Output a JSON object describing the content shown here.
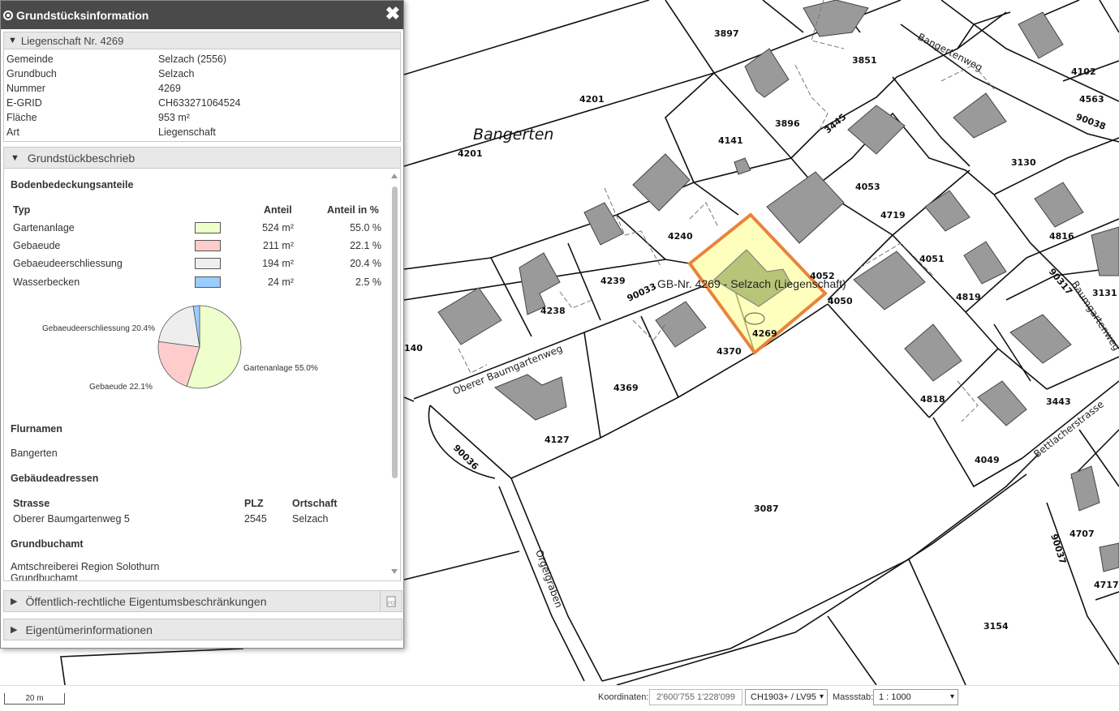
{
  "panel": {
    "title": "Grundstücksinformation",
    "close_label": "✖",
    "liegenschaft_header": "Liegenschaft Nr. 4269",
    "info": [
      {
        "key": "Gemeinde",
        "value": "Selzach (2556)"
      },
      {
        "key": "Grundbuch",
        "value": "Selzach"
      },
      {
        "key": "Nummer",
        "value": "4269"
      },
      {
        "key": "E-GRID",
        "value": "CH633271064524"
      },
      {
        "key": "Fläche",
        "value": "953 m²"
      },
      {
        "key": "Art",
        "value": "Liegenschaft"
      }
    ],
    "beschrieb_header": "Grundstückbeschrieb",
    "bodenbedeckung_title": "Bodenbedeckungsanteile",
    "cols": {
      "typ": "Typ",
      "anteil": "Anteil",
      "anteil_pct": "Anteil in %"
    },
    "rows": [
      {
        "typ": "Gartenanlage",
        "anteil": "524 m²",
        "pct": "55.0 %",
        "color": "#eeffcc"
      },
      {
        "typ": "Gebaeude",
        "anteil": "211 m²",
        "pct": "22.1 %",
        "color": "#ffcccc"
      },
      {
        "typ": "Gebaeudeerschliessung",
        "anteil": "194 m²",
        "pct": "20.4 %",
        "color": "#eeeeee"
      },
      {
        "typ": "Wasserbecken",
        "anteil": "24 m²",
        "pct": "2.5 %",
        "color": "#99ccff"
      }
    ],
    "pie_labels": {
      "garten": "Gartenanlage 55.0%",
      "gebaeude": "Gebaeude 22.1%",
      "erschl": "Gebaeudeerschliessung 20.4%"
    },
    "flurnamen_title": "Flurnamen",
    "flurnamen_value": "Bangerten",
    "adressen_title": "Gebäudeadressen",
    "adr_cols": {
      "strasse": "Strasse",
      "plz": "PLZ",
      "ort": "Ortschaft"
    },
    "adr_row": {
      "strasse": "Oberer Baumgartenweg 5",
      "plz": "2545",
      "ort": "Selzach"
    },
    "grundbuchamt_title": "Grundbuchamt",
    "grundbuchamt_value": "Amtschreiberei Region Solothurn Grundbuchamt",
    "oereb_header": "Öffentlich-rechtliche Eigentumsbeschränkungen",
    "eigentuemer_header": "Eigentümerinformationen"
  },
  "chart_data": {
    "type": "pie",
    "categories": [
      "Gartenanlage",
      "Gebaeude",
      "Gebaeudeerschliessung",
      "Wasserbecken"
    ],
    "values": [
      55.0,
      22.1,
      20.4,
      2.5
    ],
    "colors": [
      "#eeffcc",
      "#ffcccc",
      "#eeeeee",
      "#99ccff"
    ],
    "labels": [
      "Gartenanlage 55.0%",
      "Gebaeude 22.1%",
      "Gebaeudeerschliessung 20.4%"
    ]
  },
  "map": {
    "place_name": "Bangerten",
    "selection_label": "GB-Nr. 4269 - Selzach (Liegenschaft)",
    "parcels": [
      "3897",
      "3851",
      "4201",
      "4201",
      "3896",
      "4141",
      "4240",
      "4239",
      "4238",
      "4370",
      "4369",
      "4127",
      "3087",
      "4052",
      "4050",
      "4053",
      "4719",
      "4051",
      "4819",
      "4818",
      "4049",
      "3130",
      "4816",
      "3131",
      "3443",
      "4707",
      "4717",
      "3154",
      "4102",
      "4563",
      "140",
      "4269",
      "3445",
      "90038",
      "90033",
      "90036",
      "90317",
      "90037"
    ],
    "streets": [
      "Oberer Baumgartenweg",
      "Bangertenweg",
      "Baumgartenweg",
      "Bettlacherstrasse",
      "Orgelgraben"
    ]
  },
  "bottom": {
    "scale_label": "20 m",
    "coord_label": "Koordinaten:",
    "coord_value": "2'600'755 1'228'099",
    "crs_value": "CH1903+ / LV95",
    "scale_lbl": "Massstab:",
    "scale_value": "1 : 1000"
  }
}
